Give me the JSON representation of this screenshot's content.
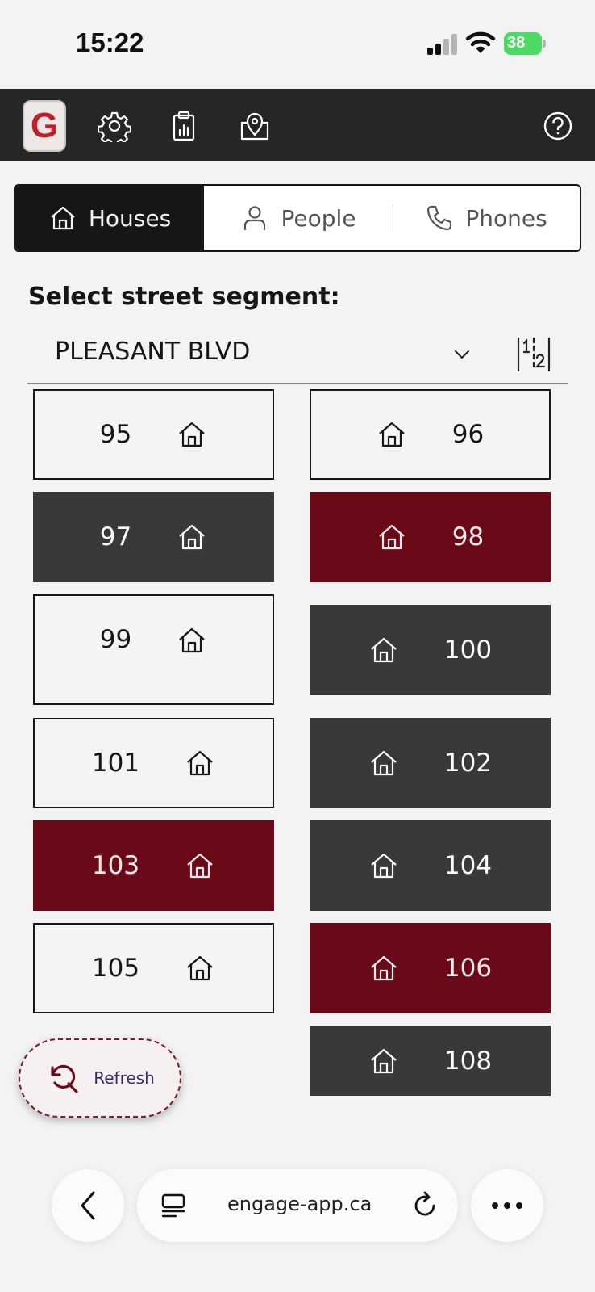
{
  "status_bar": {
    "time": "15:22",
    "battery": "38"
  },
  "app_bar": {
    "logo_letter": "G",
    "icons": [
      "gear-icon",
      "clipboard-report-icon",
      "map-pin-icon",
      "help-icon"
    ]
  },
  "tabs": [
    {
      "label": "Houses",
      "icon": "house-icon",
      "active": true
    },
    {
      "label": "People",
      "icon": "person-icon",
      "active": false
    },
    {
      "label": "Phones",
      "icon": "phone-icon",
      "active": false
    }
  ],
  "segment": {
    "label": "Select street segment:",
    "selected": "PLEASANT BLVD"
  },
  "houses": [
    {
      "number": "95",
      "status": "white"
    },
    {
      "number": "96",
      "status": "white"
    },
    {
      "number": "97",
      "status": "gray"
    },
    {
      "number": "98",
      "status": "red"
    },
    {
      "number": "99",
      "status": "white"
    },
    {
      "number": "100",
      "status": "gray"
    },
    {
      "number": "101",
      "status": "white"
    },
    {
      "number": "102",
      "status": "gray"
    },
    {
      "number": "103",
      "status": "red"
    },
    {
      "number": "104",
      "status": "gray"
    },
    {
      "number": "105",
      "status": "white"
    },
    {
      "number": "106",
      "status": "red"
    },
    {
      "number": "108",
      "status": "gray"
    }
  ],
  "colors": {
    "accent_red": "#6a0a19",
    "gray": "#393939",
    "dark": "#161616"
  },
  "refresh": {
    "label": "Refresh"
  },
  "browser": {
    "url": "engage-app.ca"
  }
}
